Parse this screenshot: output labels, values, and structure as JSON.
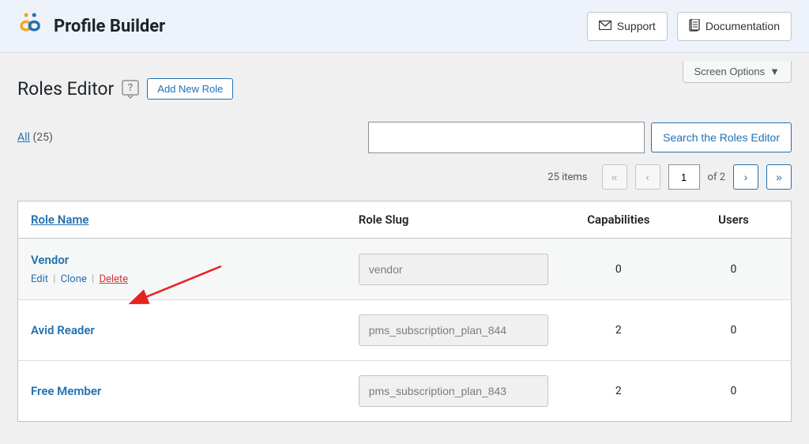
{
  "header": {
    "brand_title": "Profile Builder",
    "support_label": "Support",
    "documentation_label": "Documentation"
  },
  "topbar": {
    "screen_options_label": "Screen Options"
  },
  "page": {
    "title": "Roles Editor",
    "add_new_label": "Add New Role"
  },
  "filter": {
    "all_label": "All",
    "all_count": "(25)"
  },
  "search": {
    "value": "",
    "button_label": "Search the Roles Editor"
  },
  "pagination": {
    "items_label": "25 items",
    "current_page": "1",
    "total_label": "of 2"
  },
  "table": {
    "headers": {
      "role_name": "Role Name",
      "role_slug": "Role Slug",
      "capabilities": "Capabilities",
      "users": "Users"
    },
    "actions": {
      "edit": "Edit",
      "clone": "Clone",
      "delete": "Delete"
    },
    "rows": [
      {
        "name": "Vendor",
        "slug": "vendor",
        "capabilities": "0",
        "users": "0",
        "show_actions": true
      },
      {
        "name": "Avid Reader",
        "slug": "pms_subscription_plan_844",
        "capabilities": "2",
        "users": "0",
        "show_actions": false
      },
      {
        "name": "Free Member",
        "slug": "pms_subscription_plan_843",
        "capabilities": "2",
        "users": "0",
        "show_actions": false
      }
    ]
  }
}
